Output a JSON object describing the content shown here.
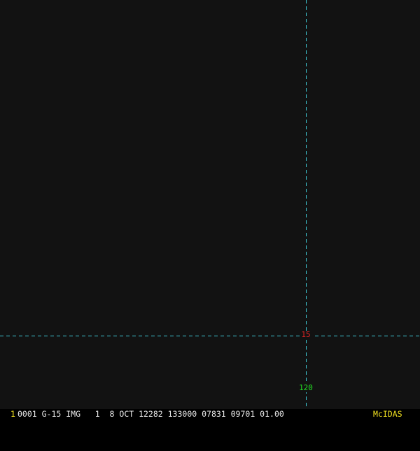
{
  "image": {
    "background_color": "#121212",
    "grid_color": "#3fc9d6"
  },
  "grid": {
    "latitude_label": "15",
    "latitude_label_color": "#e02424",
    "longitude_label": "120",
    "longitude_label_color": "#22e022"
  },
  "status_bar": {
    "frame_number": "1",
    "text": "0001 G-15 IMG   1  8 OCT 12282 133000 07831 09701 01.00",
    "brand": "McIDAS",
    "accent_color": "#f0e020"
  }
}
